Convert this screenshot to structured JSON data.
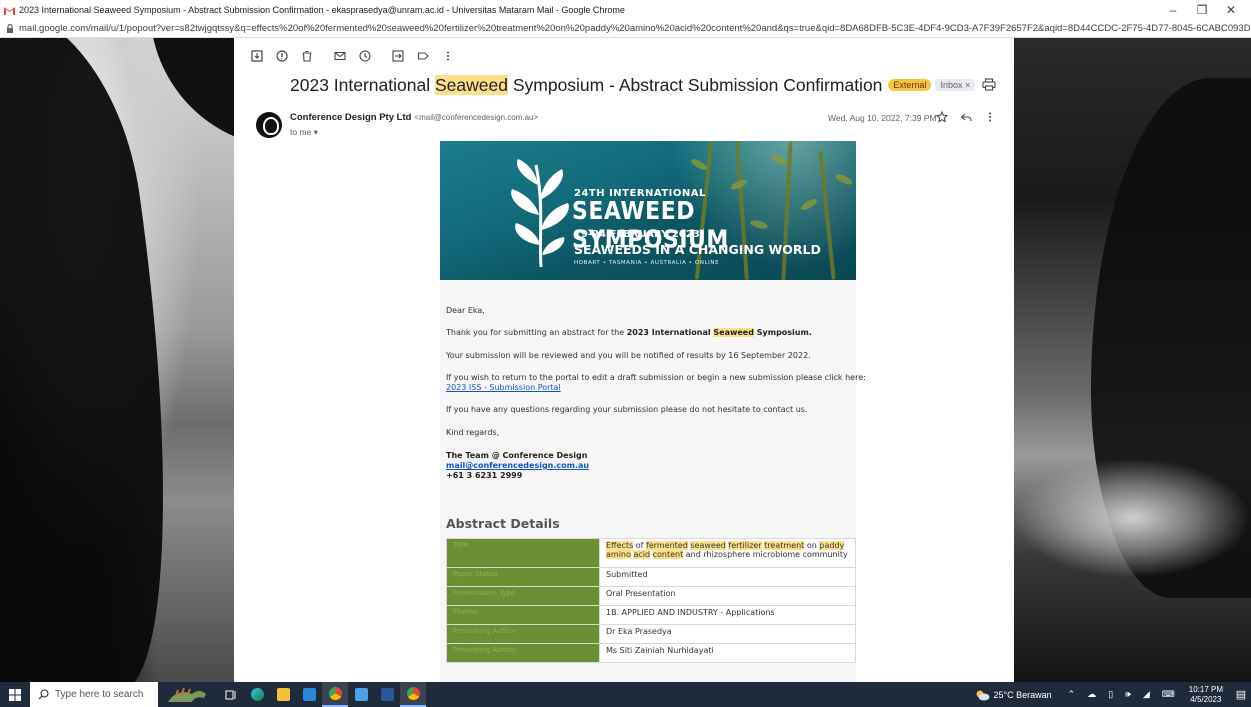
{
  "window": {
    "title": "2023 International Seaweed Symposium - Abstract Submission Confirmation - ekasprasedya@unram.ac.id - Universitas Mataram Mail - Google Chrome",
    "url": "mail.google.com/mail/u/1/popout?ver=s82twjgqtssy&q=effects%20of%20fermented%20seaweed%20fertilizer%20treatment%20on%20paddy%20amino%20acid%20content%20and&qs=true&qid=8DA68DFB-5C3E-4DF4-9CD3-A7F39F2657F2&aqid=8D44CCDC-2F75-4D77-8045-6CABC093D99C&sear..."
  },
  "subject": {
    "part1": "2023 International ",
    "highlight": "Seaweed",
    "part2": " Symposium - Abstract Submission Confirmation",
    "tag_external": "External",
    "tag_inbox": "Inbox ×"
  },
  "sender": {
    "name": "Conference Design Pty Ltd",
    "email": "<mail@conferencedesign.com.au>",
    "to": "to me ▾",
    "date": "Wed, Aug 10, 2022, 7:39 PM"
  },
  "banner": {
    "line1": "24TH INTERNATIONAL",
    "line2": "SEAWEED SYMPOSIUM",
    "line3": "19-24 FEBRUARY 2023",
    "line4": "SEAWEEDS IN A CHANGING WORLD",
    "line5": "HOBART • TASMANIA • AUSTRALIA • ONLINE"
  },
  "body": {
    "greeting": "Dear Eka,",
    "thanks_pre": "Thank you for submitting an abstract for the ",
    "thanks_bold1": "2023 International ",
    "thanks_hl": "Seaweed",
    "thanks_bold2": " Symposium.",
    "review": "Your submission will be reviewed and you will be notified of results by 16 September 2022.",
    "portal_text": "If you wish to return to the portal to edit a draft submission or begin a new submission please click here:",
    "portal_link": "2023 ISS - Submission Portal",
    "questions": "If you have any questions regarding your submission please do not hesitate to contact us.",
    "regards": "Kind regards,",
    "team": "The Team @ Conference Design",
    "team_email": "mail@conferencedesign.com.au",
    "phone": "+61 3 6231 2999"
  },
  "abstract": {
    "heading": "Abstract Details",
    "rows": [
      {
        "key": "Title",
        "value": ""
      },
      {
        "key": "Paper Status",
        "value": "Submitted"
      },
      {
        "key": "Presentation Type",
        "value": "Oral Presentation"
      },
      {
        "key": "Theme",
        "value": "1B. APPLIED AND INDUSTRY - Applications"
      },
      {
        "key": "Presenting Author",
        "value": "Dr Eka Prasedya"
      },
      {
        "key": "Presenting Author",
        "value": "Ms Siti Zainiah Nurhidayati"
      }
    ],
    "title_parts": {
      "w1": "Effects",
      "s1": " of ",
      "w2": "fermented",
      "s2": " ",
      "w3": "seaweed",
      "s3": " ",
      "w4": "fertilizer",
      "s4": " ",
      "w5": "treatment",
      "s5": " on ",
      "w6": "paddy",
      "w7": "amino",
      "s6": " ",
      "w8": "acid",
      "s7": " ",
      "w9": "content",
      "s8": " and rhizosphere microbiome community"
    }
  },
  "taskbar": {
    "search_placeholder": "Type here to search",
    "weather": "25°C Berawan",
    "time": "10:17 PM",
    "date": "4/5/2023"
  },
  "colors": {
    "highlight": "#ffe08a",
    "table_key_bg": "#6b8f32",
    "tag_external": "#f6c344",
    "taskbar": "#1f2a3a"
  }
}
